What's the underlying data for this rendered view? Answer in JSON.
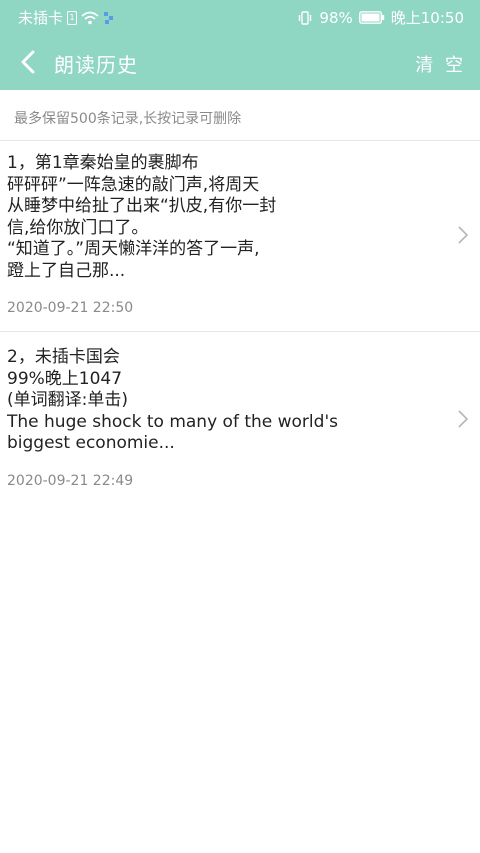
{
  "status_bar": {
    "carrier": "未插卡",
    "battery_percent": "98%",
    "time": "晚上10:50"
  },
  "header": {
    "title": "朗读历史",
    "clear_label": "清 空",
    "back_icon": "back-arrow-icon"
  },
  "hint": "最多保留500条记录,长按记录可删除",
  "history": [
    {
      "lines": [
        "1，第1章秦始皇的裹脚布",
        "砰砰砰”一阵急速的敲门声,将周天",
        "从睡梦中给扯了出来“扒皮,有你一封",
        "信,给你放门口了。",
        "“知道了。”周天懒洋洋的答了一声,",
        "蹬上了自己那..."
      ],
      "date": "2020-09-21 22:50"
    },
    {
      "lines": [
        "2，未插卡国会",
        "99%晚上1047",
        "(单词翻译:单击)",
        "The huge shock to many of the world's",
        "biggest economie..."
      ],
      "date": "2020-09-21 22:49"
    }
  ],
  "colors": {
    "accent": "#8fd6c3",
    "text": "#222222",
    "muted": "#8a8a8a"
  }
}
